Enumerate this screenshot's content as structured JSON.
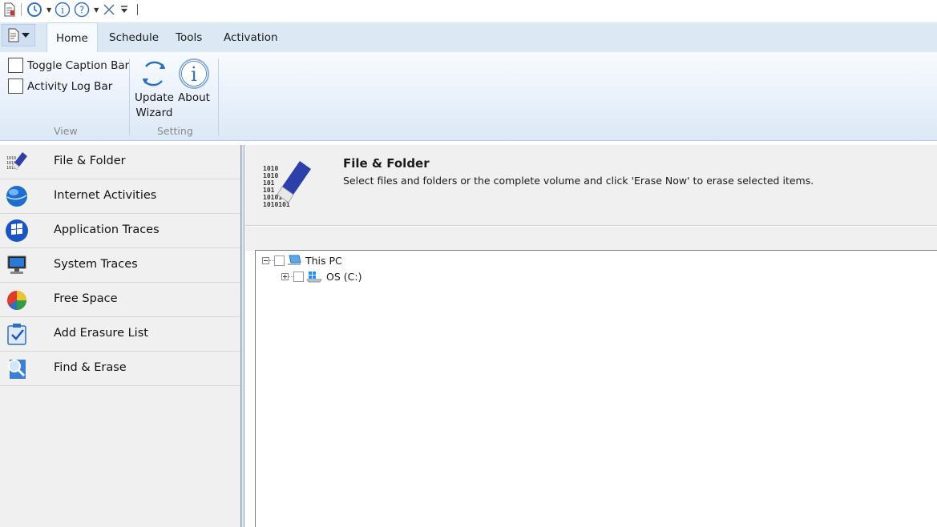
{
  "qat": {
    "icons": [
      "document-icon",
      "clock-icon",
      "info-icon",
      "help-icon",
      "close-icon",
      "customize-icon"
    ]
  },
  "tabs": [
    {
      "label": "Home",
      "active": true
    },
    {
      "label": "Schedule",
      "active": false
    },
    {
      "label": "Tools",
      "active": false
    },
    {
      "label": "Activation",
      "active": false
    }
  ],
  "ribbon": {
    "view_group": {
      "label": "View",
      "toggle_caption_bar": "Toggle Caption Bar",
      "activity_log_bar": "Activity Log Bar"
    },
    "setting_group": {
      "label": "Setting",
      "update_line1": "Update",
      "update_line2": "Wizard",
      "about": "About"
    }
  },
  "nav": {
    "items": [
      {
        "label": "File & Folder",
        "icon": "eraser-icon"
      },
      {
        "label": "Internet Activities",
        "icon": "globe-icon"
      },
      {
        "label": "Application Traces",
        "icon": "windows-icon"
      },
      {
        "label": "System Traces",
        "icon": "monitor-icon"
      },
      {
        "label": "Free Space",
        "icon": "pie-chart-icon"
      },
      {
        "label": "Add Erasure List",
        "icon": "clipboard-check-icon"
      },
      {
        "label": "Find & Erase",
        "icon": "magnifier-icon"
      }
    ]
  },
  "main": {
    "title": "File & Folder",
    "description": "Select files and folders or the complete volume and click 'Erase Now' to erase selected items."
  },
  "tree": {
    "root": "This PC",
    "child": "OS (C:)"
  },
  "colors": {
    "ribbon_bg": "#dde8f5",
    "accent_blue": "#2f6fc0"
  }
}
